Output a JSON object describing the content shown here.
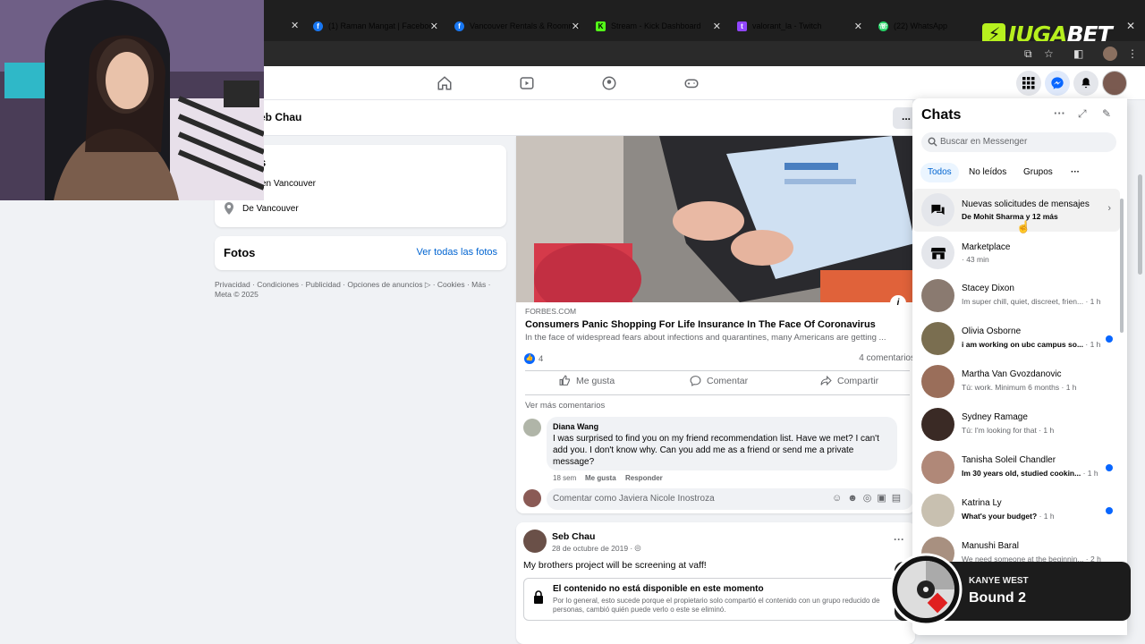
{
  "tabs": [
    {
      "title": "(1) Raman Mangat | Facebook",
      "icon": "facebook-icon",
      "color": "#1877f2"
    },
    {
      "title": "Vancouver Rentals & Roommat",
      "icon": "facebook-icon",
      "color": "#1877f2"
    },
    {
      "title": "Stream - Kick Dashboard",
      "icon": "kick-icon",
      "color": "#53fc18"
    },
    {
      "title": "valorant_la - Twitch",
      "icon": "twitch-icon",
      "color": "#9146ff"
    },
    {
      "title": "(22) WhatsApp",
      "icon": "whatsapp-icon",
      "color": "#25d366"
    }
  ],
  "overlay_brand": {
    "juga": "JUGA",
    "bet": "BET",
    "color": "#b6f01e"
  },
  "subheader": {
    "name": "eb Chau",
    "more": "..."
  },
  "intro": {
    "title_fragment": "s",
    "lives_in": "en Vancouver",
    "from_prefix": "De",
    "from_city": "Vancouver"
  },
  "photos": {
    "title": "Fotos",
    "see_all": "Ver todas las fotos"
  },
  "footer": {
    "links": "Privacidad · Condiciones · Publicidad · Opciones de anuncios ▷ · Cookies · Más ·",
    "copyright": "Meta © 2025"
  },
  "post1": {
    "source": "FORBES.COM",
    "headline": "Consumers Panic Shopping For Life Insurance In The Face Of Coronavirus",
    "summary": "In the face of widespread fears about infections and quarantines, many Americans are getting ...",
    "likes": "4",
    "comments_count": "4 comentarios",
    "actions": {
      "like": "Me gusta",
      "comment": "Comentar",
      "share": "Compartir"
    },
    "more_comments": "Ver más comentarios",
    "comment": {
      "author": "Diana Wang",
      "text": "I was surprised to find you on my friend recommendation list. Have we met? I can't add you. I don't know why. Can you add me as a friend or send me a private message?",
      "time": "18 sem",
      "like": "Me gusta",
      "reply": "Responder"
    },
    "comment_placeholder": "Comentar como Javiera Nicole Inostroza"
  },
  "post2": {
    "author": "Seb Chau",
    "date": "28 de octubre de 2019 · ",
    "text": "My brothers project will be screening at vaff!",
    "unavailable_title": "El contenido no está disponible en este momento",
    "unavailable_text": "Por lo general, esto sucede porque el propietario solo compartió el contenido con un grupo reducido de personas, cambió quién puede verlo o este se eliminó."
  },
  "chats": {
    "title": "Chats",
    "search_placeholder": "Buscar en Messenger",
    "filters": [
      "Todos",
      "No leídos",
      "Grupos",
      "···"
    ],
    "rows": [
      {
        "name": "Nuevas solicitudes de mensajes",
        "preview": "De Mohit Sharma y 12 más",
        "time": "",
        "unread": true,
        "avatar": "#e4e6eb",
        "icon": "chat-bubbles-icon"
      },
      {
        "name": "Marketplace",
        "preview": "· 43 min",
        "time": "",
        "unread": false,
        "avatar": "#e4e6eb",
        "icon": "marketplace-icon"
      },
      {
        "name": "Stacey Dixon",
        "preview": "Im super chill, quiet, discreet, frien...",
        "time": "· 1 h",
        "unread": false,
        "avatar": "#8a7a70"
      },
      {
        "name": "Olivia Osborne",
        "preview": "i am working on ubc campus so...",
        "time": "· 1 h",
        "unread": true,
        "avatar": "#7a6e50"
      },
      {
        "name": "Martha Van Gvozdanovic",
        "preview": "Tú: work. Minimum 6 months",
        "time": "· 1 h",
        "unread": false,
        "avatar": "#9a6e5a"
      },
      {
        "name": "Sydney Ramage",
        "preview": "Tú: I'm looking for that",
        "time": "· 1 h",
        "unread": false,
        "avatar": "#3a2a25"
      },
      {
        "name": "Tanisha Soleil Chandler",
        "preview": "Im 30 years old, studied cookin...",
        "time": "· 1 h",
        "unread": true,
        "avatar": "#b08878"
      },
      {
        "name": "Katrina Ly",
        "preview": "What's your budget?",
        "time": "· 1 h",
        "unread": true,
        "avatar": "#c8c0b0"
      },
      {
        "name": "Manushi Baral",
        "preview": "We need someone at the beginnin...",
        "time": "· 2 h",
        "unread": false,
        "avatar": "#a89080"
      }
    ]
  },
  "now_playing": {
    "artist": "KANYE WEST",
    "track": "Bound 2"
  }
}
